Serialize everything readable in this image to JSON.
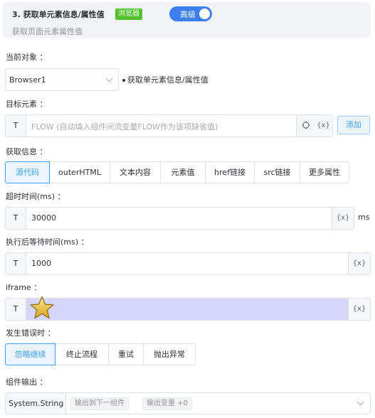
{
  "header": {
    "title": "3. 获取单元素信息/属性值",
    "badge": "浏览器",
    "toggle_label": "高级",
    "subtitle": "获取页面元素属性值"
  },
  "current_object": {
    "label": "当前对象 ：",
    "value": "Browser1",
    "description": "获取单元素信息/属性值"
  },
  "target": {
    "label": "目标元素 ：",
    "prefix": "T",
    "placeholder": "FLOW (自动填入组件间流变量FLOW作为该项缺省值)",
    "var_label": "{x}",
    "add_button": "添加"
  },
  "info": {
    "label": "获取信息 ：",
    "options": [
      "源代码",
      "outerHTML",
      "文本内容",
      "元素值",
      "href链接",
      "src链接",
      "更多属性"
    ],
    "selected": "源代码"
  },
  "timeout": {
    "label": "超时时间(ms) ：",
    "prefix": "T",
    "value": "30000",
    "var_label": "{x}",
    "unit": "ms"
  },
  "wait": {
    "label": "执行后等待时间(ms) ：",
    "prefix": "T",
    "value": "1000",
    "var_label": "{x}"
  },
  "iframe": {
    "label": "iframe ：",
    "prefix": "T",
    "value": "",
    "var_label": "{x}"
  },
  "on_error": {
    "label": "发生错误时 ：",
    "options": [
      "忽略继续",
      "终止流程",
      "重试",
      "抛出异常"
    ],
    "selected": "忽略继续"
  },
  "output": {
    "label": "组件输出 ：",
    "type": "System.String",
    "tags": [
      "输出到下一组件",
      "输出变量 +0"
    ]
  },
  "colors": {
    "accent": "#409eff",
    "badge": "#53c22b",
    "toggle": "#3d7ef5",
    "iframe_highlight": "#d6d6fb",
    "star": "#f2c94c"
  }
}
